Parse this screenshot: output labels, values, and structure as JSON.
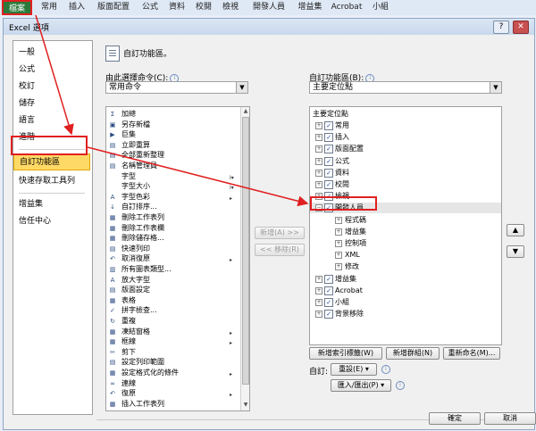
{
  "ribbon": {
    "tabs": [
      "檔案",
      "常用",
      "插入",
      "版面配置",
      "公式",
      "資料",
      "校閱",
      "檢視",
      "開發人員",
      "增益集",
      "Acrobat",
      "小組"
    ]
  },
  "dialog": {
    "title": "Excel 選項",
    "help": "?",
    "close": "✕"
  },
  "nav": {
    "items": [
      "一般",
      "公式",
      "校訂",
      "儲存",
      "語言",
      "進階",
      "自訂功能區",
      "快速存取工具列",
      "增益集",
      "信任中心"
    ],
    "selected": "自訂功能區"
  },
  "header": {
    "title": "自訂功能區。"
  },
  "left": {
    "choose_label": "由此選擇命令(C):",
    "choose_value": "常用命令",
    "commands": [
      {
        "icon": "Σ",
        "label": "加總"
      },
      {
        "icon": "▣",
        "label": "另存新檔"
      },
      {
        "icon": "▶",
        "label": "巨集"
      },
      {
        "icon": "▤",
        "label": "立即重算"
      },
      {
        "icon": "▤",
        "label": "全部重新整理"
      },
      {
        "icon": "▤",
        "label": "名稱管理員"
      },
      {
        "icon": "",
        "label": "字型",
        "sub": "I▾"
      },
      {
        "icon": "",
        "label": "字型大小",
        "sub": "I▾"
      },
      {
        "icon": "A",
        "label": "字型色彩",
        "sub": "▸"
      },
      {
        "icon": "↓",
        "label": "自訂排序..."
      },
      {
        "icon": "▦",
        "label": "刪除工作表列"
      },
      {
        "icon": "▦",
        "label": "刪除工作表欄"
      },
      {
        "icon": "▦",
        "label": "刪除儲存格..."
      },
      {
        "icon": "▤",
        "label": "快速列印"
      },
      {
        "icon": "↶",
        "label": "取消復原",
        "sub": "▸"
      },
      {
        "icon": "▥",
        "label": "所有圖表類型..."
      },
      {
        "icon": "A",
        "label": "放大字型"
      },
      {
        "icon": "▤",
        "label": "版面設定"
      },
      {
        "icon": "▦",
        "label": "表格"
      },
      {
        "icon": "✓",
        "label": "拼字檢查..."
      },
      {
        "icon": "↻",
        "label": "重複"
      },
      {
        "icon": "▦",
        "label": "凍結窗格",
        "sub": "▸"
      },
      {
        "icon": "▦",
        "label": "框線",
        "sub": "▸"
      },
      {
        "icon": "✂",
        "label": "剪下"
      },
      {
        "icon": "▤",
        "label": "設定列印範圍"
      },
      {
        "icon": "▦",
        "label": "設定格式化的條件",
        "sub": "▸"
      },
      {
        "icon": "∞",
        "label": "連線"
      },
      {
        "icon": "↶",
        "label": "復原",
        "sub": "▸"
      },
      {
        "icon": "▦",
        "label": "插入工作表列"
      }
    ]
  },
  "middle": {
    "add": "新增(A) >>",
    "remove": "<< 移除(R)"
  },
  "right": {
    "customize_label": "自訂功能區(B):",
    "customize_value": "主要定位點",
    "tree_header": "主要定位點",
    "tree": [
      {
        "label": "常用",
        "level": 0,
        "exp": "⊞",
        "checked": true
      },
      {
        "label": "插入",
        "level": 0,
        "exp": "⊞",
        "checked": true
      },
      {
        "label": "版面配置",
        "level": 0,
        "exp": "⊞",
        "checked": true
      },
      {
        "label": "公式",
        "level": 0,
        "exp": "⊞",
        "checked": true
      },
      {
        "label": "資料",
        "level": 0,
        "exp": "⊞",
        "checked": true
      },
      {
        "label": "校閱",
        "level": 0,
        "exp": "⊞",
        "checked": true
      },
      {
        "label": "檢視",
        "level": 0,
        "exp": "⊞",
        "checked": true
      },
      {
        "label": "開發人員",
        "level": 0,
        "exp": "⊟",
        "checked": true,
        "selected": true
      },
      {
        "label": "程式碼",
        "level": 1,
        "exp": "⊞"
      },
      {
        "label": "增益集",
        "level": 1,
        "exp": "⊞"
      },
      {
        "label": "控制項",
        "level": 1,
        "exp": "⊞"
      },
      {
        "label": "XML",
        "level": 1,
        "exp": "⊞"
      },
      {
        "label": "修改",
        "level": 1,
        "exp": "⊞"
      },
      {
        "label": "增益集",
        "level": 0,
        "exp": "⊞",
        "checked": true
      },
      {
        "label": "Acrobat",
        "level": 0,
        "exp": "⊞",
        "checked": true
      },
      {
        "label": "小組",
        "level": 0,
        "exp": "⊞",
        "checked": true
      },
      {
        "label": "背景移除",
        "level": 0,
        "exp": "⊞",
        "checked": true
      }
    ],
    "new_tab": "新增索引標籤(W)",
    "new_group": "新增群組(N)",
    "rename": "重新命名(M)...",
    "custom_label": "自訂:",
    "reset": "重設(E) ▾",
    "import_export": "匯入/匯出(P) ▾"
  },
  "footer": {
    "ok": "確定",
    "cancel": "取消"
  },
  "colors": {
    "highlight": "#ffd966",
    "annotation": "#e02020",
    "file_tab": "#2b7a3b"
  }
}
